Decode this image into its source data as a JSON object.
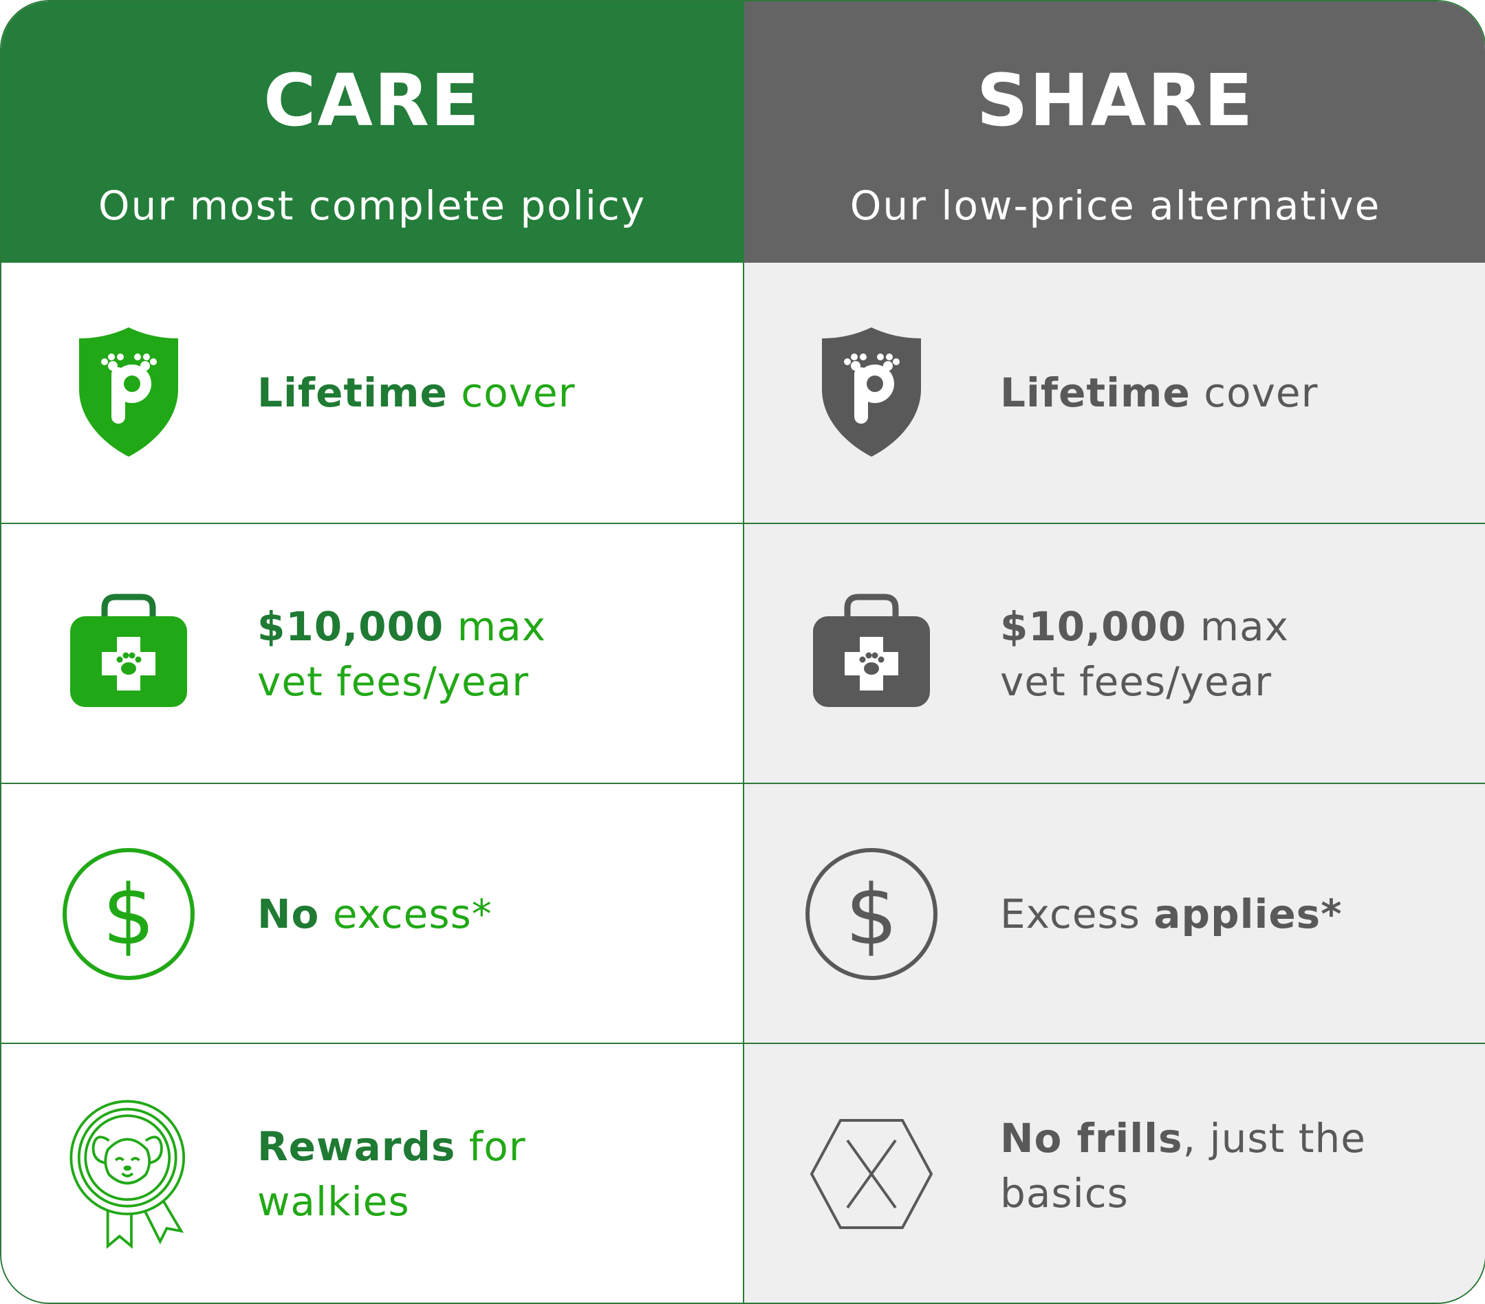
{
  "care": {
    "title": "CARE",
    "subtitle": "Our most complete policy",
    "rows": [
      {
        "icon": "shield-paw-icon",
        "bold": "Lifetime",
        "rest": " cover"
      },
      {
        "icon": "vet-bag-icon",
        "bold": "$10,000",
        "rest": " max",
        "line2": "vet fees/year"
      },
      {
        "icon": "dollar-circle-icon",
        "bold": "No",
        "rest": " excess*"
      },
      {
        "icon": "dog-medal-icon",
        "bold": "Rewards",
        "rest": " for",
        "line2": "walkies"
      }
    ]
  },
  "share": {
    "title": "SHARE",
    "subtitle": "Our low-price alternative",
    "rows": [
      {
        "icon": "shield-paw-icon",
        "bold": "Lifetime",
        "rest": " cover"
      },
      {
        "icon": "vet-bag-icon",
        "bold": "$10,000",
        "rest": " max",
        "line2": "vet fees/year"
      },
      {
        "icon": "dollar-circle-icon",
        "pre": "Excess ",
        "bold": "applies*"
      },
      {
        "icon": "hexagon-x-icon",
        "bold": "No frills",
        "rest": ", just the",
        "line2": "basics"
      }
    ]
  },
  "colors": {
    "care_header": "#247d3a",
    "share_header": "#646464",
    "care_icon": "#21a816",
    "share_icon": "#595959",
    "share_bg": "#efefef"
  }
}
